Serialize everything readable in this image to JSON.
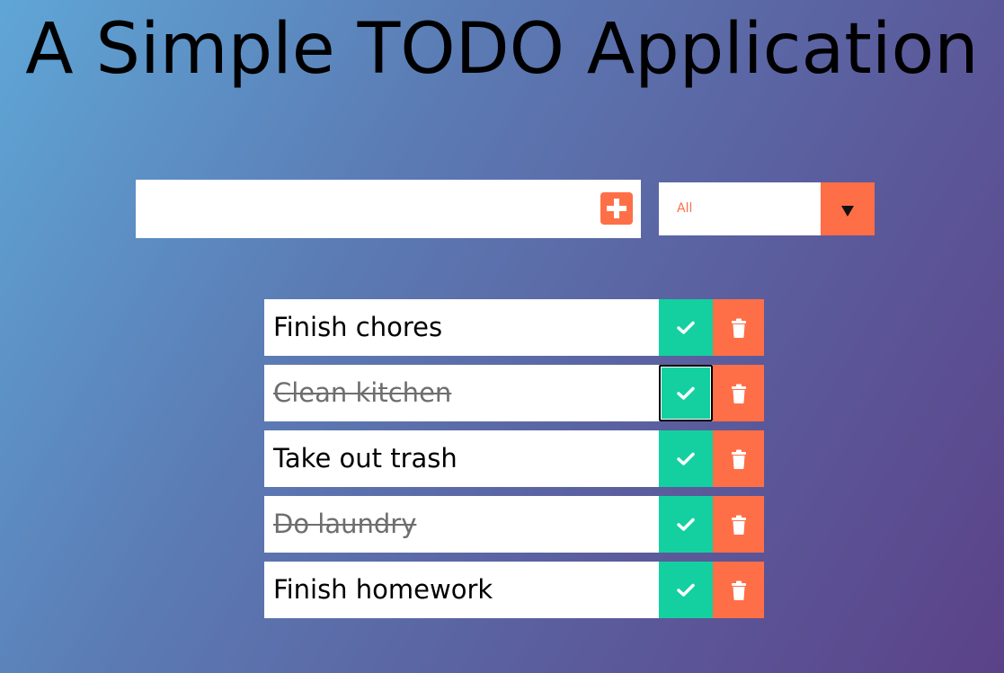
{
  "header": {
    "title": "A Simple TODO Application"
  },
  "add_form": {
    "input_value": "",
    "placeholder": "",
    "add_icon": "plus-square-icon"
  },
  "filter": {
    "selected": "All",
    "arrow_icon": "caret-down-icon"
  },
  "todos": [
    {
      "text": "Finish chores",
      "completed": false
    },
    {
      "text": "Clean kitchen",
      "completed": true
    },
    {
      "text": "Take out trash",
      "completed": false
    },
    {
      "text": "Do laundry",
      "completed": true
    },
    {
      "text": "Finish homework",
      "completed": false
    }
  ],
  "colors": {
    "accent": "#ff6f47",
    "complete": "#14d0a0",
    "background_start": "#5fa6d6",
    "background_end": "#5b4288"
  }
}
